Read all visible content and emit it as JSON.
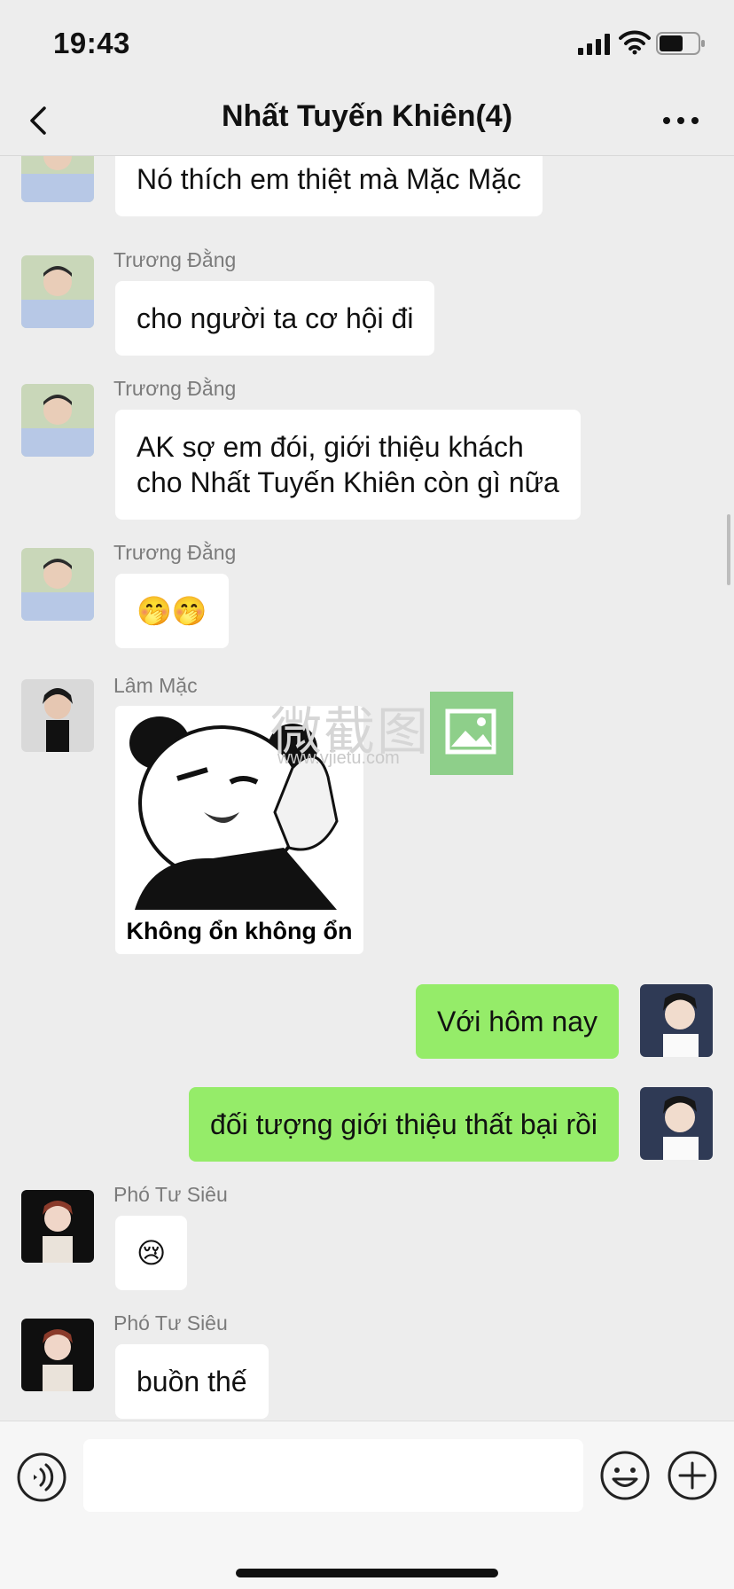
{
  "status_bar": {
    "time": "19:43"
  },
  "header": {
    "title": "Nhất Tuyến Khiên(4)"
  },
  "messages": [
    {
      "sender": "",
      "text": "Nó thích em thiệt mà Mặc Mặc"
    },
    {
      "sender": "Trương Đằng",
      "text": "cho người ta cơ hội đi"
    },
    {
      "sender": "Trương Đằng",
      "line1": "AK sợ em đói, giới thiệu khách",
      "line2": "cho Nhất Tuyến Khiên còn gì nữa"
    },
    {
      "sender": "Trương Đằng",
      "text": "🤭🤭"
    },
    {
      "sender": "Lâm Mặc",
      "sticker_caption": "Không ổn không ổn"
    },
    {
      "sender": "me",
      "text": "Với hôm nay"
    },
    {
      "sender": "me",
      "text": "đối tượng giới thiệu thất bại rồi"
    },
    {
      "sender": "Phó Tư Siêu",
      "text": "😢"
    },
    {
      "sender": "Phó Tư Siêu",
      "text": "buồn thế"
    }
  ],
  "watermark": {
    "brand": "微截图",
    "url": "www.vjietu.com"
  },
  "input": {
    "value": ""
  },
  "icons": {
    "back": "chevron-left-icon",
    "more": "more-icon",
    "voice": "voice-icon",
    "emoji": "emoji-icon",
    "plus": "plus-icon"
  },
  "colors": {
    "background": "#ededed",
    "my_bubble": "#95ec69",
    "other_bubble": "#ffffff"
  }
}
